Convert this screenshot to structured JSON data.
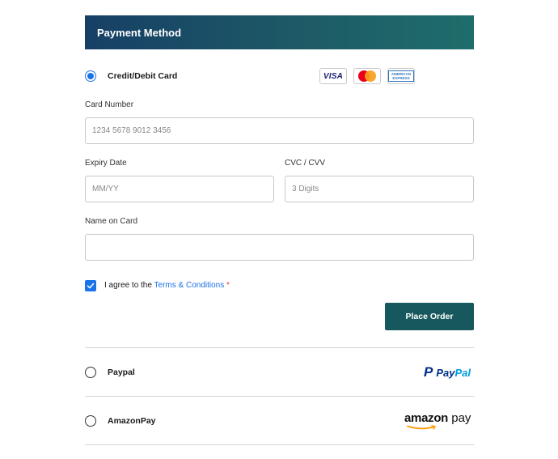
{
  "header": {
    "title": "Payment Method"
  },
  "card_method": {
    "label": "Credit/Debit Card",
    "selected": true,
    "logos": {
      "visa": "VISA",
      "amex": "AMERICAN EXPRESS"
    }
  },
  "fields": {
    "card_number": {
      "label": "Card Number",
      "placeholder": "1234 5678 9012 3456"
    },
    "expiry": {
      "label": "Expiry Date",
      "placeholder": "MM/YY"
    },
    "cvc": {
      "label": "CVC / CVV",
      "placeholder": "3 Digits"
    },
    "name": {
      "label": "Name on Card",
      "placeholder": ""
    }
  },
  "terms": {
    "checked": true,
    "prefix": "I agree to the ",
    "link": "Terms & Conditions",
    "required_mark": "*"
  },
  "place_order": {
    "label": "Place Order"
  },
  "paypal": {
    "label": "Paypal",
    "logo_text_1": "Pay",
    "logo_text_2": "Pal",
    "logo_mark": "P"
  },
  "amazonpay": {
    "label": "AmazonPay",
    "logo_text_1": "amazon",
    "logo_text_2": " pay"
  },
  "colors": {
    "header_gradient_start": "#173f66",
    "header_gradient_end": "#1e6d6b",
    "accent_blue": "#1a73e8",
    "button": "#16585d",
    "required": "#e53935"
  }
}
